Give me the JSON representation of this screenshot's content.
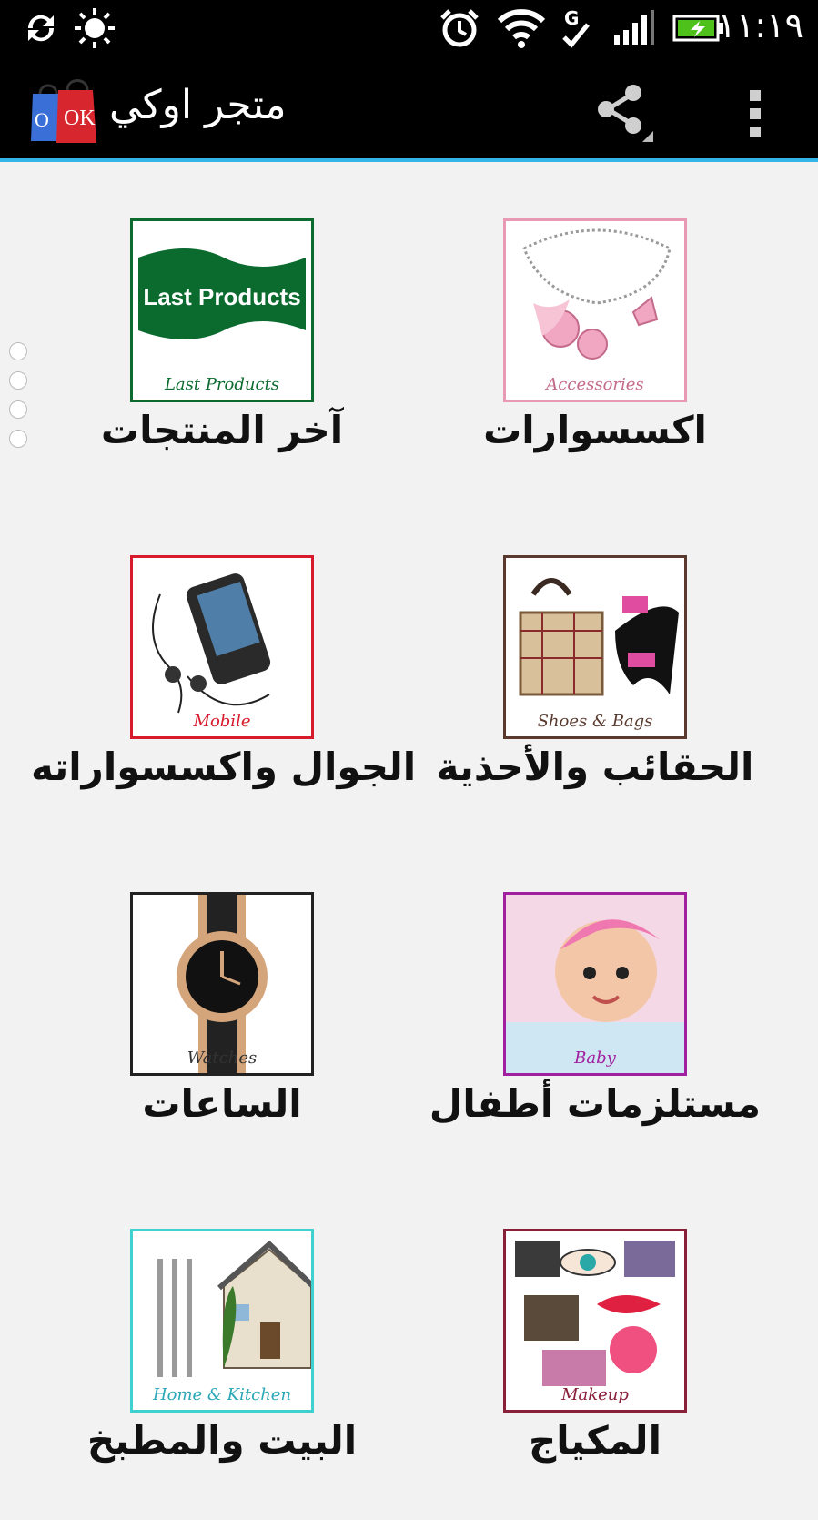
{
  "status_bar": {
    "time": "١١:١٩",
    "icons": [
      "sync-icon",
      "brightness-icon",
      "alarm-icon",
      "wifi-icon",
      "g-data-icon",
      "signal-icon",
      "battery-charging-icon"
    ]
  },
  "action_bar": {
    "title": "متجر اوكي",
    "logo_text": "OK",
    "logo_left": "O"
  },
  "categories": [
    {
      "label": "آخر المنتجات",
      "caption": "Last Products",
      "banner": "Last Products",
      "accent": "#0b6b2e"
    },
    {
      "label": "اكسسوارات",
      "caption": "Accessories",
      "accent": "#e89ab5"
    },
    {
      "label": "الجوال واكسسواراته",
      "caption": "Mobile",
      "accent": "#d81b2c"
    },
    {
      "label": "الحقائب والأحذية",
      "caption": "Shoes & Bags",
      "accent": "#5a3a2e"
    },
    {
      "label": "الساعات",
      "caption": "Watches",
      "accent": "#222222"
    },
    {
      "label": "مستلزمات أطفال",
      "caption": "Baby",
      "accent": "#a020a0"
    },
    {
      "label": "البيت والمطبخ",
      "caption": "Home & Kitchen",
      "accent": "#3fd0d0"
    },
    {
      "label": "المكياج",
      "caption": "Makeup",
      "accent": "#8a1f3a"
    }
  ]
}
